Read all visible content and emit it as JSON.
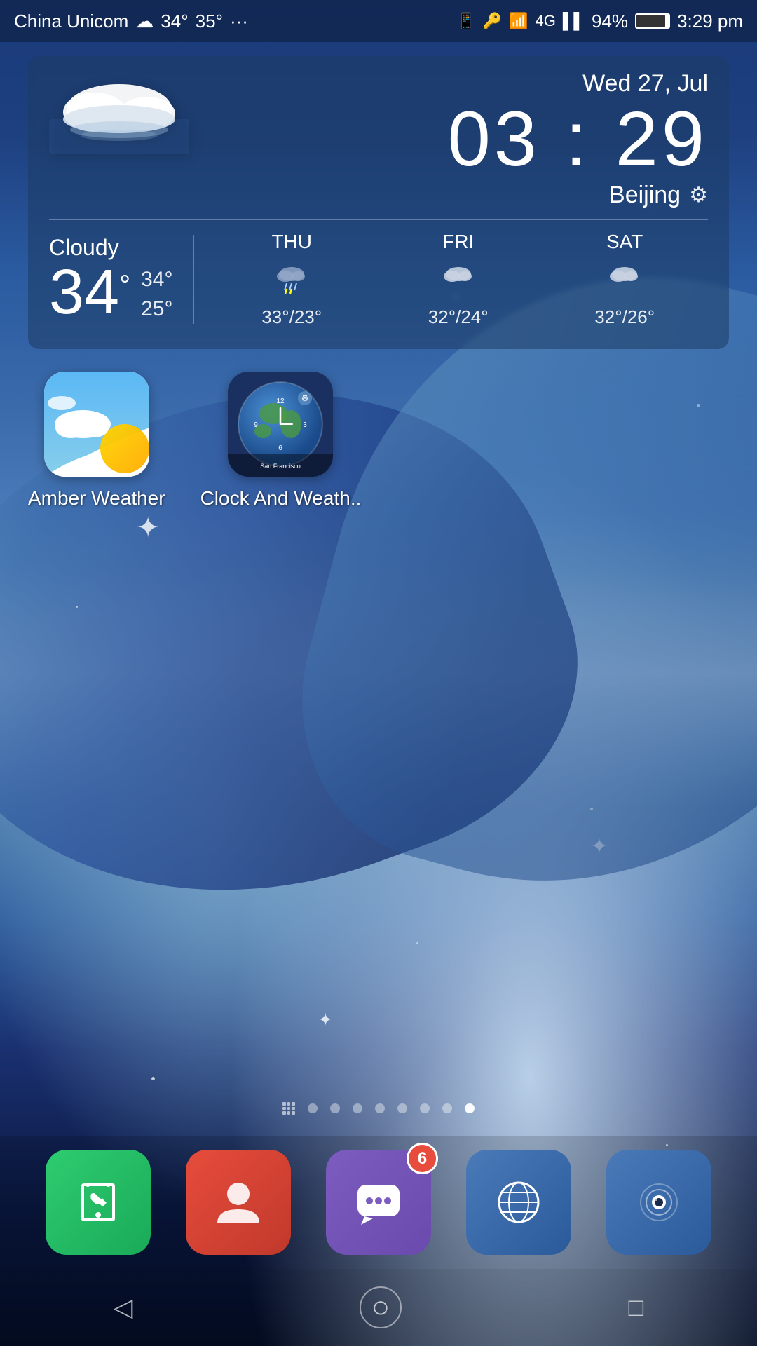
{
  "statusBar": {
    "carrier": "China Unicom",
    "weather": "☁",
    "temp": "34°",
    "tempHigh": "35°",
    "dots": "···",
    "battery": "94%",
    "time": "3:29 pm"
  },
  "weatherWidget": {
    "date": "Wed 27, Jul",
    "time": "03 : 29",
    "city": "Beijing",
    "condition": "Cloudy",
    "currentTemp": "34",
    "highTemp": "34°",
    "lowTemp": "25°",
    "forecast": [
      {
        "day": "THU",
        "high": "33°",
        "low": "23°",
        "icon": "storm"
      },
      {
        "day": "FRI",
        "high": "32°",
        "low": "24°",
        "icon": "cloud"
      },
      {
        "day": "SAT",
        "high": "32°",
        "low": "26°",
        "icon": "cloud"
      }
    ]
  },
  "apps": [
    {
      "name": "Amber Weather",
      "type": "amber"
    },
    {
      "name": "Clock And Weath..",
      "type": "clock"
    }
  ],
  "pageIndicators": {
    "total": 8,
    "activeIndex": 7
  },
  "dock": [
    {
      "name": "Phone",
      "type": "phone",
      "badge": null
    },
    {
      "name": "Contacts",
      "type": "contacts",
      "badge": null
    },
    {
      "name": "Messages",
      "type": "messages",
      "badge": "6"
    },
    {
      "name": "Browser",
      "type": "browser",
      "badge": null
    },
    {
      "name": "Camera",
      "type": "camera",
      "badge": null
    }
  ],
  "nav": {
    "back": "◁",
    "home": "○",
    "recent": "□"
  }
}
